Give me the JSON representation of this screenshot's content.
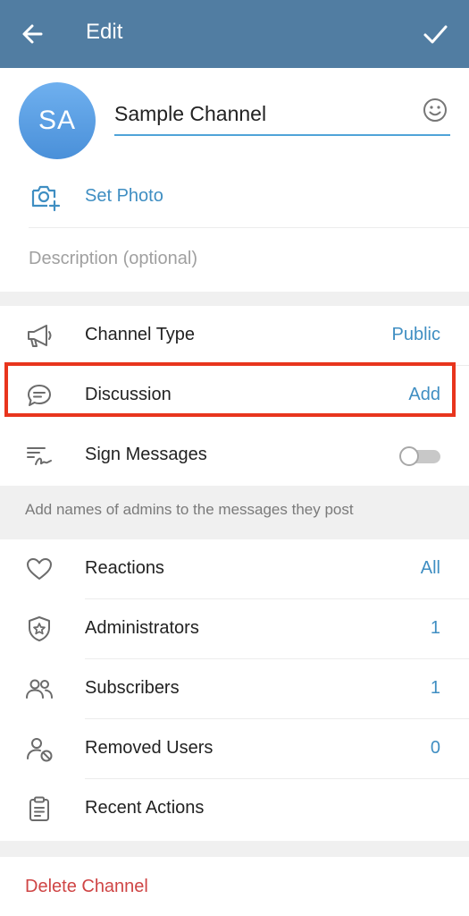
{
  "header": {
    "title": "Edit",
    "back_icon": "arrow-left-icon",
    "confirm_icon": "check-icon"
  },
  "channel": {
    "avatar_initials": "SA",
    "name": "Sample Channel",
    "set_photo_label": "Set Photo",
    "description_placeholder": "Description (optional)"
  },
  "settings": [
    {
      "label": "Channel Type",
      "value": "Public",
      "icon": "megaphone-icon"
    },
    {
      "label": "Discussion",
      "value": "Add",
      "icon": "chat-bubble-icon"
    },
    {
      "label": "Sign Messages",
      "value": "",
      "icon": "signature-icon",
      "toggle": "off"
    }
  ],
  "sign_hint": "Add names of admins to the messages they post",
  "management": [
    {
      "label": "Reactions",
      "value": "All",
      "icon": "heart-icon"
    },
    {
      "label": "Administrators",
      "value": "1",
      "icon": "shield-star-icon"
    },
    {
      "label": "Subscribers",
      "value": "1",
      "icon": "users-icon"
    },
    {
      "label": "Removed Users",
      "value": "0",
      "icon": "user-blocked-icon"
    },
    {
      "label": "Recent Actions",
      "value": "",
      "icon": "clipboard-icon"
    }
  ],
  "delete_label": "Delete Channel",
  "colors": {
    "header": "#517da2",
    "accent": "#3f8ec2",
    "highlight": "#e8351d",
    "danger": "#cf4545"
  }
}
